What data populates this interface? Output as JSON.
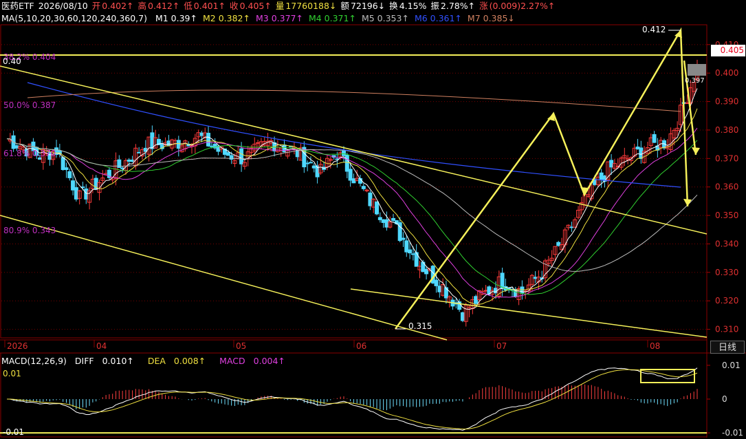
{
  "header": {
    "name": "医药ETF",
    "date": "2026/08/10",
    "open_label": "开",
    "open": "0.402↑",
    "high_label": "高",
    "high": "0.412↑",
    "low_label": "低",
    "low": "0.401↑",
    "close_label": "收",
    "close": "0.405↑",
    "volume_label": "量",
    "volume": "17760188↓",
    "amount_label": "额",
    "amount": "72196↓",
    "turnover_label": "换",
    "turnover": "4.15%",
    "amplitude_label": "振",
    "amplitude": "2.78%↑",
    "change_label": "涨",
    "change": "(0.009)2.27%↑"
  },
  "ma_line": {
    "title": "MA(5,10,20,30,60,120,240,360,7)",
    "items": [
      {
        "name": "M1",
        "value": "0.39↑",
        "color": "#ffffff"
      },
      {
        "name": "M2",
        "value": "0.382↑",
        "color": "#f0e040"
      },
      {
        "name": "M3",
        "value": "0.377↑",
        "color": "#e040e0"
      },
      {
        "name": "M4",
        "value": "0.371↑",
        "color": "#30d030"
      },
      {
        "name": "M5",
        "value": "0.353↑",
        "color": "#bbbbbb"
      },
      {
        "name": "M6",
        "value": "0.361↑",
        "color": "#3050ff"
      },
      {
        "name": "M7",
        "value": "0.385↓",
        "color": "#d08060"
      }
    ]
  },
  "fib_labels": [
    {
      "text": "38.2% 0.404",
      "value": 0.404,
      "color": "#c030c0"
    },
    {
      "text": "50.0% 0.387",
      "value": 0.387,
      "color": "#c030c0"
    },
    {
      "text": "61.8% 0.370",
      "value": 0.37,
      "color": "#c030c0"
    },
    {
      "text": "80.9% 0.343",
      "value": 0.343,
      "color": "#c030c0"
    }
  ],
  "annotations": {
    "left_value": "0.40",
    "high_mark": "0.412",
    "low_mark": "0.315",
    "ma_tag": "0.397",
    "current_price": "0.405",
    "day_button": "日线"
  },
  "x_ticks": [
    "2026",
    "04",
    "05",
    "06",
    "07",
    "08"
  ],
  "macd_header": {
    "title": "MACD(12,26,9)",
    "diff_label": "DIFF",
    "diff": "0.010↑",
    "dea_label": "DEA",
    "dea": "0.008↑",
    "macd_label": "MACD",
    "macd": "0.004↑",
    "top_left": "0.01",
    "bottom_left": "-0.01"
  },
  "macd_axis": [
    "0.01",
    "0",
    "-0.01"
  ],
  "chart_data": {
    "type": "candlestick",
    "ylim": [
      0.307,
      0.416
    ],
    "yticks": [
      0.31,
      0.32,
      0.33,
      0.34,
      0.35,
      0.36,
      0.37,
      0.38,
      0.39,
      0.4,
      0.41
    ],
    "colors": {
      "up": "#ff3b3b",
      "down": "#4fd8ff"
    },
    "candles": [],
    "macd_ylim": [
      -0.011,
      0.011
    ]
  }
}
